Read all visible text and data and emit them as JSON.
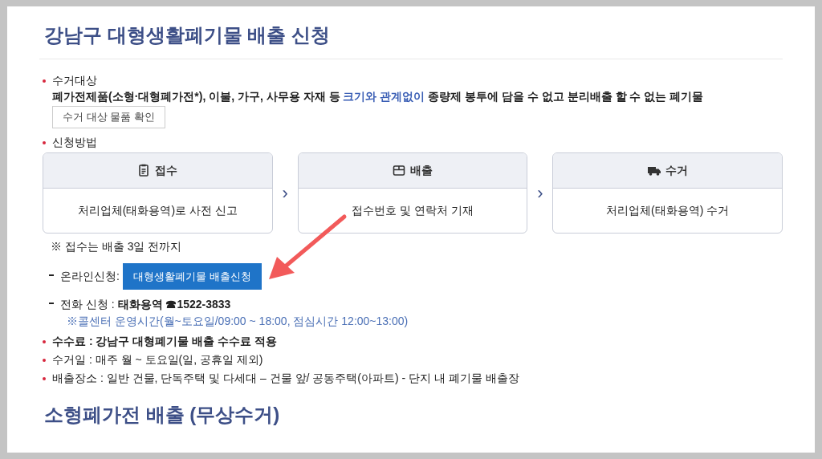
{
  "title": "강남구 대형생활폐기물 배출 신청",
  "items": [
    {
      "kind": "target",
      "label": "수거대상",
      "segments": [
        {
          "text": "폐가전제품(소형·대형폐가전*), 이불, 가구, 사무용 자재 등 ",
          "kind": "strong"
        },
        {
          "text": "크기와 관계없이",
          "kind": "highlight"
        },
        {
          "text": " 종량제 봉투에 담을 수 없고 분리배출 할 수 없는 폐기물",
          "kind": "strong"
        }
      ],
      "button": "수거 대상 물품 확인"
    },
    {
      "kind": "method",
      "label": "신청방법",
      "steps": [
        {
          "kind": "clipboard",
          "title": "접수",
          "text": "처리업체(태화용역)로 사전 신고"
        },
        {
          "kind": "box",
          "title": "배출",
          "text": "접수번호 및 연락처 기재"
        },
        {
          "kind": "truck",
          "title": "수거",
          "text": "처리업체(태화용역) 수거"
        }
      ],
      "separator": "›",
      "note": "※ 접수는 배출 3일 전까지",
      "online": {
        "label": "온라인신청:",
        "button": "대형생활폐기물 배출신청"
      },
      "phone": {
        "text": "전화 신청 : **태화용역 ☎1522-3833**",
        "hours": "※콜센터 운영시간(월~토요일/09:00 ~ 18:00, 점심시간 12:00~13:00)"
      }
    },
    {
      "kind": "line",
      "bold": true,
      "text": "수수료 : 강남구 대형폐기물 배출 수수료 적용"
    },
    {
      "kind": "line",
      "bold": false,
      "text": "수거일 : 매주 월 ~ 토요일(일, 공휴일 제외)"
    },
    {
      "kind": "line",
      "bold": false,
      "text": "배출장소 : 일반 건물, 단독주택 및 다세대 – 건물 앞/ 공동주택(아파트) - 단지 내 폐기물 배출장"
    }
  ],
  "subtitle": "소형폐가전 배출 (무상수거)"
}
